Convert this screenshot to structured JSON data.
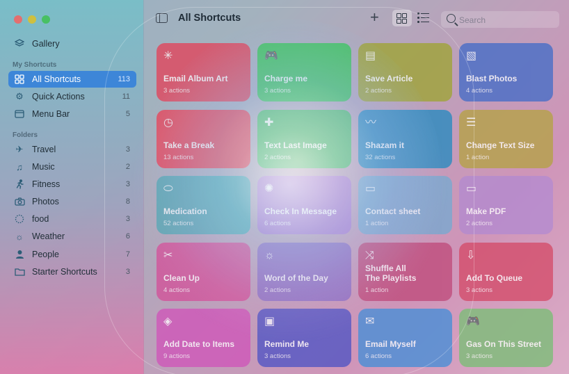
{
  "window": {
    "title": "All Shortcuts"
  },
  "sidebar": {
    "gallery": {
      "label": "Gallery",
      "icon": "layers-icon"
    },
    "my_shortcuts_label": "My Shortcuts",
    "folders_label": "Folders",
    "items": [
      {
        "label": "All Shortcuts",
        "count": "113",
        "icon": "grid-icon"
      },
      {
        "label": "Quick Actions",
        "count": "11",
        "icon": "gear-icon"
      },
      {
        "label": "Menu Bar",
        "count": "5",
        "icon": "menubar-icon"
      }
    ],
    "folders": [
      {
        "label": "Travel",
        "count": "3",
        "icon": "airplane-icon"
      },
      {
        "label": "Music",
        "count": "2",
        "icon": "music-note-icon"
      },
      {
        "label": "Fitness",
        "count": "3",
        "icon": "runner-icon"
      },
      {
        "label": "Photos",
        "count": "8",
        "icon": "camera-icon"
      },
      {
        "label": "food",
        "count": "3",
        "icon": "dotted-circle-icon"
      },
      {
        "label": "Weather",
        "count": "6",
        "icon": "sun-icon"
      },
      {
        "label": "People",
        "count": "7",
        "icon": "person-icon"
      },
      {
        "label": "Starter Shortcuts",
        "count": "3",
        "icon": "folder-icon"
      }
    ]
  },
  "toolbar": {
    "title": "All Shortcuts",
    "search_placeholder": "Search"
  },
  "cards": [
    {
      "title": "Email Album Art",
      "subtitle": "3 actions",
      "icon": "sparkle-icon",
      "color": "#e0495f"
    },
    {
      "title": "Charge me",
      "subtitle": "3 actions",
      "icon": "game-controller-icon",
      "color": "#3cc45a"
    },
    {
      "title": "Save Article",
      "subtitle": "2 actions",
      "icon": "reader-icon",
      "color": "#a0a43a"
    },
    {
      "title": "Blast Photos",
      "subtitle": "4 actions",
      "icon": "photo-icon",
      "color": "#4b6fc7"
    },
    {
      "title": "Take a Break",
      "subtitle": "13 actions",
      "icon": "timer-icon",
      "color": "#e8455a"
    },
    {
      "title": "Text Last Image",
      "subtitle": "2 actions",
      "icon": "message-plus-icon",
      "color": "#4bbd6a"
    },
    {
      "title": "Shazam it",
      "subtitle": "32 actions",
      "icon": "waveform-icon",
      "color": "#2e8bbf"
    },
    {
      "title": "Change Text Size",
      "subtitle": "1 action",
      "icon": "sliders-icon",
      "color": "#b6a24b"
    },
    {
      "title": "Medication",
      "subtitle": "52 actions",
      "icon": "pill-icon",
      "color": "#55a8b4"
    },
    {
      "title": "Check In Message",
      "subtitle": "6 actions",
      "icon": "lightbulb-icon",
      "color": "#b07cd2"
    },
    {
      "title": "Contact sheet",
      "subtitle": "1 action",
      "icon": "document-icon",
      "color": "#7ba8cf"
    },
    {
      "title": "Make PDF",
      "subtitle": "2 actions",
      "icon": "document-icon",
      "color": "#b48bcf"
    },
    {
      "title": "Clean Up",
      "subtitle": "4 actions",
      "icon": "scissors-icon",
      "color": "#d2559b"
    },
    {
      "title": "Word of the Day",
      "subtitle": "2 actions",
      "icon": "sun-icon",
      "color": "#8e6fc4"
    },
    {
      "title": "Shuffle All\nThe Playlists",
      "subtitle": "1 action",
      "icon": "shuffle-icon",
      "color": "#c04f7e"
    },
    {
      "title": "Add To Queue",
      "subtitle": "3 actions",
      "icon": "tray-down-icon",
      "color": "#d44f6d"
    },
    {
      "title": "Add Date to Items",
      "subtitle": "9 actions",
      "icon": "layers-icon",
      "color": "#cf59b9"
    },
    {
      "title": "Remind Me",
      "subtitle": "3 actions",
      "icon": "briefcase-icon",
      "color": "#5658c4"
    },
    {
      "title": "Email Myself",
      "subtitle": "6 actions",
      "icon": "envelope-icon",
      "color": "#4d8fd6"
    },
    {
      "title": "Gas On This Street",
      "subtitle": "3 actions",
      "icon": "game-controller-icon",
      "color": "#7fbd7a"
    }
  ]
}
